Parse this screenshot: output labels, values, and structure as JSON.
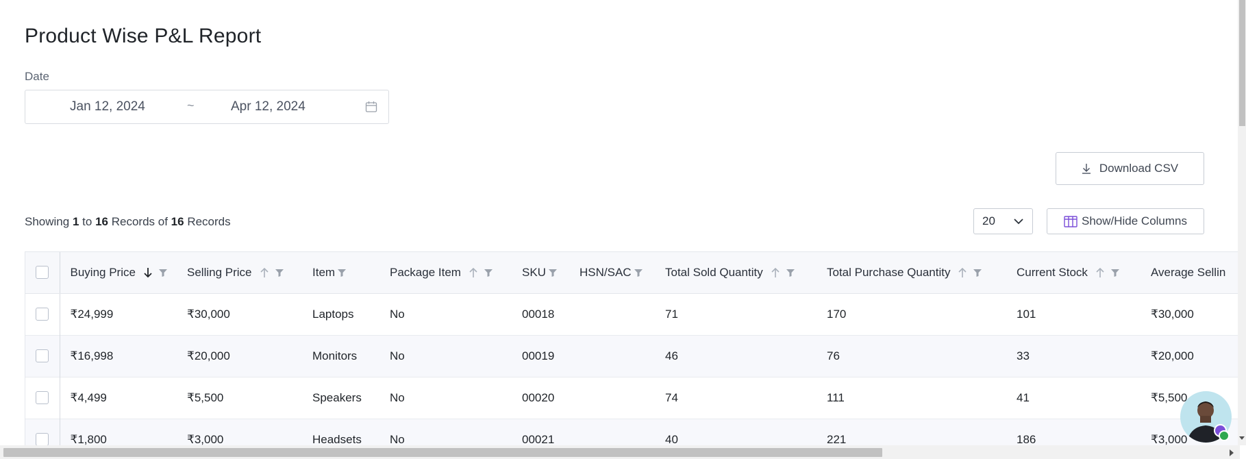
{
  "page": {
    "title": "Product Wise P&L Report"
  },
  "filters": {
    "date_label": "Date",
    "date_start": "Jan 12, 2024",
    "date_separator": "~",
    "date_end": "Apr 12, 2024"
  },
  "toolbar": {
    "download_label": "Download CSV",
    "columns_label": "Show/Hide Columns",
    "page_size": "20"
  },
  "records": {
    "prefix": "Showing",
    "from": "1",
    "to_word": "to",
    "to": "16",
    "records_of": "Records of",
    "total": "16",
    "suffix": "Records"
  },
  "table": {
    "headers": {
      "buying_price": "Buying Price",
      "selling_price": "Selling Price",
      "item": "Item",
      "package_item": "Package Item",
      "sku": "SKU",
      "hsn_sac": "HSN/SAC",
      "total_sold_qty": "Total Sold Quantity",
      "total_purchase_qty": "Total Purchase Quantity",
      "current_stock": "Current Stock",
      "average_selling": "Average Sellin"
    },
    "rows": [
      {
        "buying_price": "₹24,999",
        "selling_price": "₹30,000",
        "item": "Laptops",
        "package_item": "No",
        "sku": "00018",
        "hsn_sac": "",
        "total_sold_qty": "71",
        "total_purchase_qty": "170",
        "current_stock": "101",
        "average_selling": "₹30,000"
      },
      {
        "buying_price": "₹16,998",
        "selling_price": "₹20,000",
        "item": "Monitors",
        "package_item": "No",
        "sku": "00019",
        "hsn_sac": "",
        "total_sold_qty": "46",
        "total_purchase_qty": "76",
        "current_stock": "33",
        "average_selling": "₹20,000"
      },
      {
        "buying_price": "₹4,499",
        "selling_price": "₹5,500",
        "item": "Speakers",
        "package_item": "No",
        "sku": "00020",
        "hsn_sac": "",
        "total_sold_qty": "74",
        "total_purchase_qty": "111",
        "current_stock": "41",
        "average_selling": "₹5,500"
      },
      {
        "buying_price": "₹1,800",
        "selling_price": "₹3,000",
        "item": "Headsets",
        "package_item": "No",
        "sku": "00021",
        "hsn_sac": "",
        "total_sold_qty": "40",
        "total_purchase_qty": "221",
        "current_stock": "186",
        "average_selling": "₹3,000"
      }
    ]
  },
  "colors": {
    "accent": "#7b4ed8",
    "online": "#2fa84f"
  },
  "icons": [
    "calendar-icon",
    "download-icon",
    "columns-icon",
    "chevron-down-icon",
    "sort-down-icon",
    "sort-up-icon",
    "filter-icon"
  ]
}
